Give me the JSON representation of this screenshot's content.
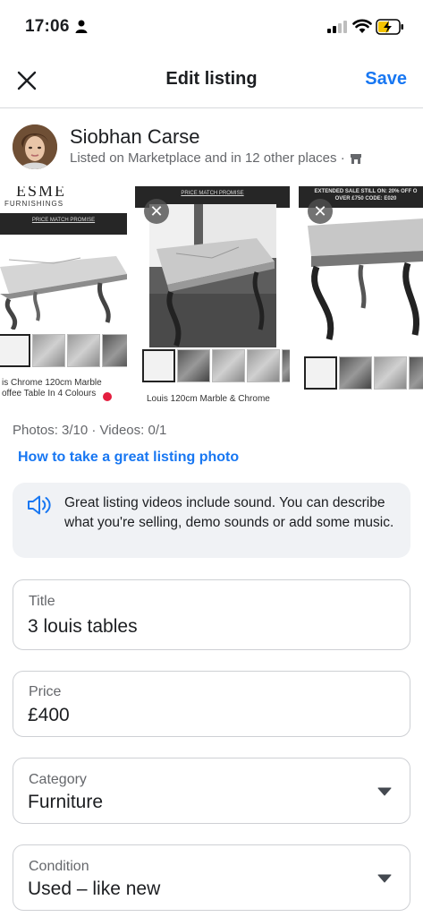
{
  "status_bar": {
    "time": "17:06"
  },
  "header": {
    "title": "Edit listing",
    "save_label": "Save"
  },
  "profile": {
    "name": "Siobhan Carse",
    "subtitle": "Listed on Marketplace and in 12 other places ·"
  },
  "photos": [
    {
      "brand": "ESME",
      "brand_sub": "FURNISHINGS",
      "banner": "PRICE MATCH PROMISE",
      "caption_line1": "is Chrome 120cm Marble",
      "caption_line2": "offee Table In 4 Colours"
    },
    {
      "banner": "PRICE MATCH PROMISE",
      "caption": "Louis 120cm Marble & Chrome"
    },
    {
      "banner_line1": "EXTENDED SALE STILL ON: 20% OFF O",
      "banner_line2": "OVER £750 CODE: E020"
    }
  ],
  "media": {
    "counts": "Photos: 3/10 · Videos: 0/1",
    "tip_link": "How to take a great listing photo"
  },
  "info": {
    "text": "Great listing videos include sound. You can describe what you're selling, demo sounds or add some music."
  },
  "fields": {
    "title": {
      "label": "Title",
      "value": "3 louis tables"
    },
    "price": {
      "label": "Price",
      "value": "£400"
    },
    "category": {
      "label": "Category",
      "value": "Furniture"
    },
    "condition": {
      "label": "Condition",
      "value": "Used – like new"
    }
  },
  "colors": {
    "accent": "#1877f2",
    "secondary_text": "#65676b",
    "info_bg": "#f0f2f5"
  },
  "icons": [
    "person-icon",
    "signal-icon",
    "wifi-icon",
    "battery-charging-icon",
    "close-icon",
    "shop-icon",
    "remove-photo-icon",
    "speaker-icon",
    "chevron-down-icon"
  ]
}
